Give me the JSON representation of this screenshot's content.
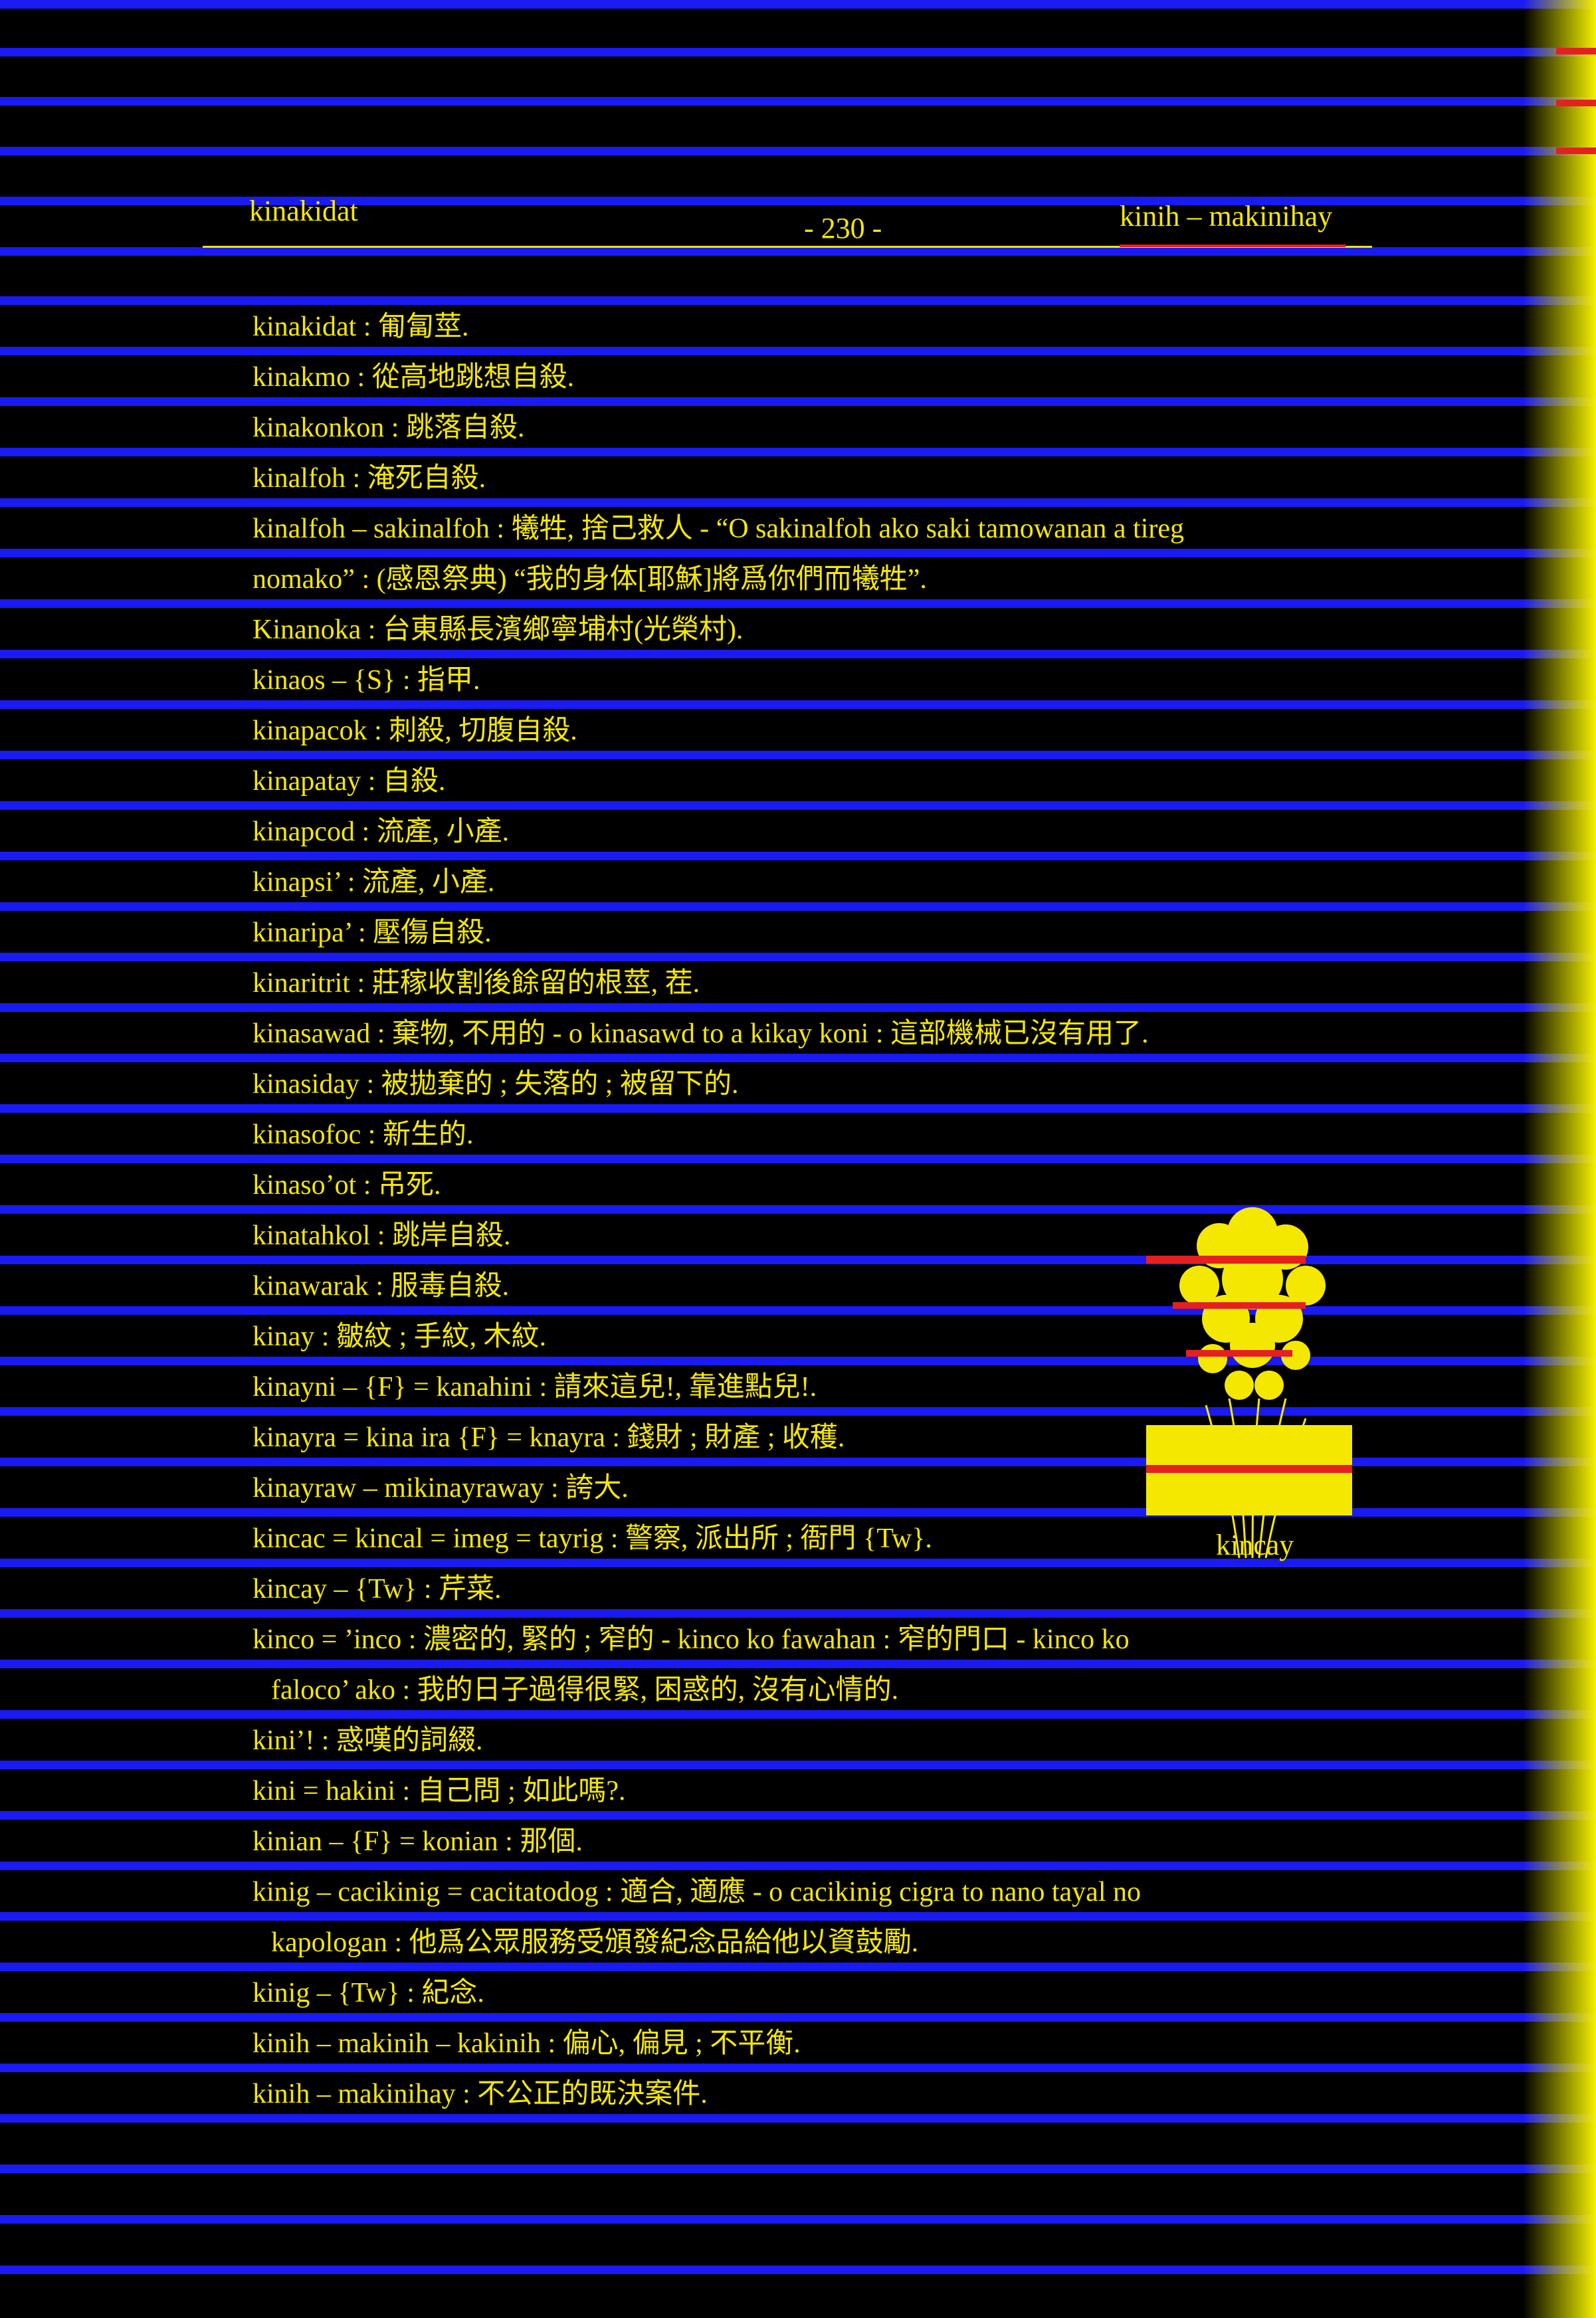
{
  "header": {
    "left": "kinakidat",
    "page_number": "- 230 -",
    "right": "kinih – makinihay"
  },
  "entries": [
    "kinakidat : 匍匐莖.",
    "kinakmo : 從高地跳想自殺.",
    "kinakonkon : 跳落自殺.",
    "kinalfoh : 淹死自殺.",
    "kinalfoh – sakinalfoh : 犧牲, 捨己救人 - “O sakinalfoh ako saki tamowanan a tireg",
    "nomako” : (感恩祭典) “我的身体[耶穌]將爲你們而犧牲”.",
    "Kinanoka : 台東縣長濱鄉寧埔村(光榮村).",
    "kinaos – {S} : 指甲.",
    "kinapacok : 刺殺, 切腹自殺.",
    "kinapatay : 自殺.",
    "kinapcod : 流產, 小產.",
    "kinapsi’ : 流產, 小產.",
    "kinaripa’ : 壓傷自殺.",
    "kinaritrit : 莊稼收割後餘留的根莖, 茬.",
    "kinasawad : 棄物, 不用的 - o kinasawd to a kikay koni : 這部機械已沒有用了.",
    "kinasiday : 被拋棄的 ; 失落的 ; 被留下的.",
    "kinasofoc : 新生的.",
    "kinaso’ot : 吊死.",
    "kinatahkol : 跳岸自殺.",
    "kinawarak : 服毒自殺.",
    "kinay : 皺紋 ; 手紋, 木紋.",
    "kinayni – {F} = kanahini : 請來這兒!, 靠進點兒!.",
    "kinayra = kina ira {F} = knayra : 錢財 ; 財產 ; 收穫.",
    "kinayraw – mikinayraway : 誇大.",
    "kincac = kincal = imeg = tayrig : 警察, 派出所 ; 衙門 {Tw}.",
    "kincay – {Tw} : 芹菜.",
    "kinco = ’inco : 濃密的, 緊的 ; 窄的 - kinco ko fawahan : 窄的門口 - kinco ko",
    "faloco’ ako : 我的日子過得很緊, 困惑的, 沒有心情的.",
    "kini’! : 惑嘆的詞綴.",
    "kini = hakini : 自己問 ; 如此嗎?.",
    "kinian – {F} = konian : 那個.",
    "kinig – cacikinig = cacitatodog : 適合, 適應 - o cacikinig cigra to nano tayal no",
    "kapologan : 他爲公眾服務受頒發紀念品給他以資鼓勵.",
    "kinig – {Tw} : 紀念.",
    "kinih – makinih – kakinih : 偏心, 偏見 ; 不平衡.",
    "kinih – makinihay : 不公正的既決案件."
  ],
  "figure": {
    "caption": "kincay"
  },
  "colors": {
    "background": "#000000",
    "text": "#f5e800",
    "ruling": "#1a1af2",
    "accent": "#e52020"
  }
}
